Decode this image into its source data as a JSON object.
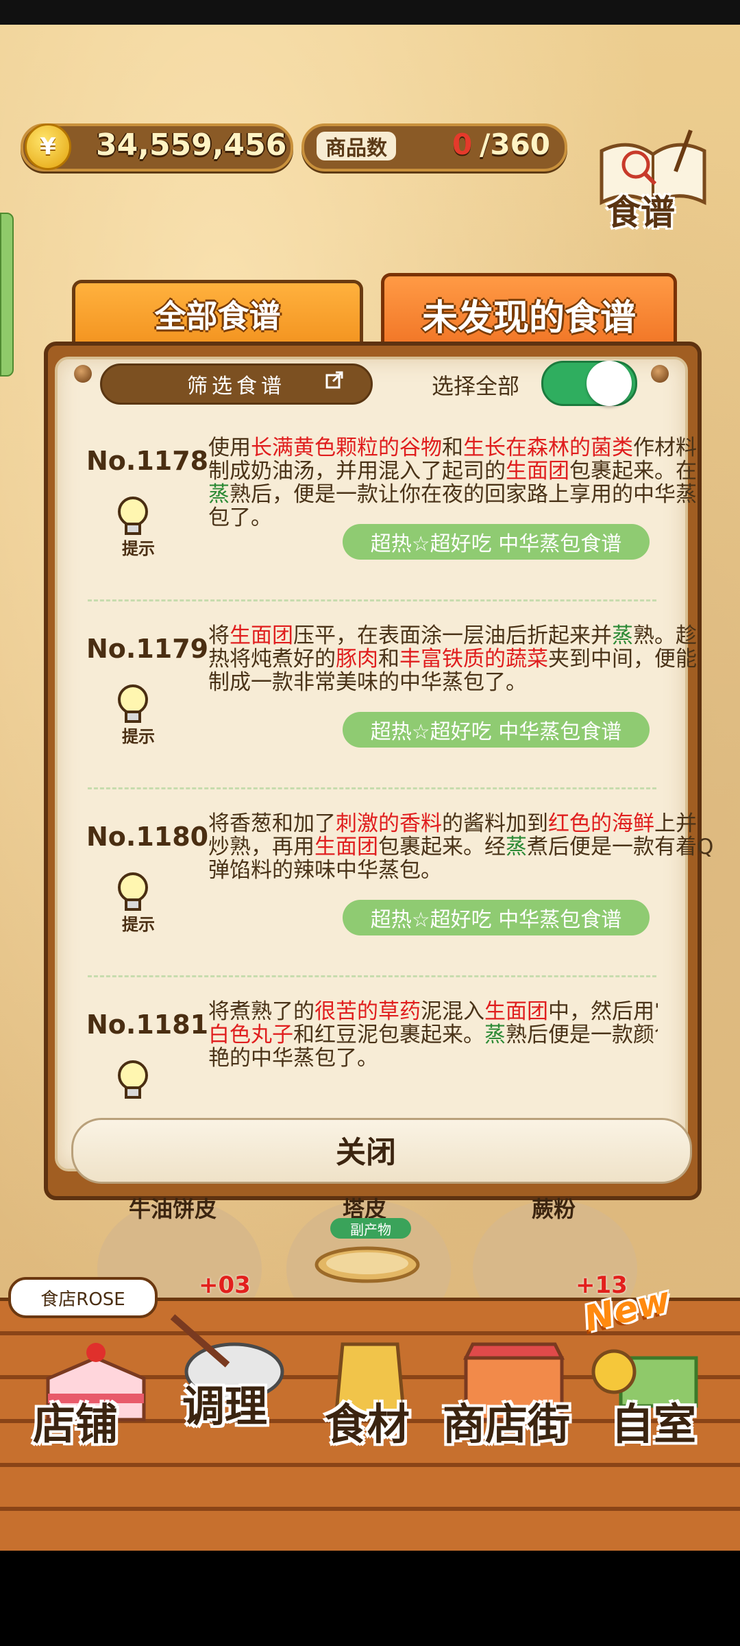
{
  "hud": {
    "money": "34,559,456",
    "money_icon": "¥",
    "goods_label": "商品数",
    "goods_count": "0",
    "goods_total": "/360",
    "recipe_book_label": "食谱"
  },
  "tabs": {
    "all": "全部食谱",
    "undiscovered": "未发现的食谱"
  },
  "toolbar": {
    "filter_label": "筛选食谱",
    "select_all_label": "选择全部",
    "select_all_on": true
  },
  "recipes": [
    {
      "number": "No.1178",
      "hint": "提示",
      "parts": [
        {
          "t": "使用",
          "c": ""
        },
        {
          "t": "长满黄色颗粒的谷物",
          "c": "r"
        },
        {
          "t": "和",
          "c": ""
        },
        {
          "t": "生长在森林的菌类",
          "c": "r"
        },
        {
          "t": "作材料制成奶油汤，并用混入了起司的",
          "c": ""
        },
        {
          "t": "生面团",
          "c": "r"
        },
        {
          "t": "包裹起来。在",
          "c": ""
        },
        {
          "t": "蒸",
          "c": "g"
        },
        {
          "t": "熟后，便是一款让你在夜的回家路上享用的中华蒸包了。",
          "c": ""
        }
      ],
      "tag": "超热☆超好吃 中华蒸包食谱"
    },
    {
      "number": "No.1179",
      "hint": "提示",
      "parts": [
        {
          "t": "将",
          "c": ""
        },
        {
          "t": "生面团",
          "c": "r"
        },
        {
          "t": "压平，在表面涂一层油后折起来并",
          "c": ""
        },
        {
          "t": "蒸",
          "c": "g"
        },
        {
          "t": "熟。趁热将炖煮好的",
          "c": ""
        },
        {
          "t": "豚肉",
          "c": "r"
        },
        {
          "t": "和",
          "c": ""
        },
        {
          "t": "丰富铁质的蔬菜",
          "c": "r"
        },
        {
          "t": "夹到中间，便能制成一款非常美味的中华蒸包了。",
          "c": ""
        }
      ],
      "tag": "超热☆超好吃 中华蒸包食谱"
    },
    {
      "number": "No.1180",
      "hint": "提示",
      "parts": [
        {
          "t": "将香葱和加了",
          "c": ""
        },
        {
          "t": "刺激的香料",
          "c": "r"
        },
        {
          "t": "的酱料加到",
          "c": ""
        },
        {
          "t": "红色的海鲜",
          "c": "r"
        },
        {
          "t": "上并炒熟，再用",
          "c": ""
        },
        {
          "t": "生面团",
          "c": "r"
        },
        {
          "t": "包裹起来。经",
          "c": ""
        },
        {
          "t": "蒸",
          "c": "g"
        },
        {
          "t": "煮后便是一款有着Q弹馅料的辣味中华蒸包。",
          "c": ""
        }
      ],
      "tag": "超热☆超好吃 中华蒸包食谱"
    },
    {
      "number": "No.1181",
      "hint": "提示",
      "parts": [
        {
          "t": "将煮熟了的",
          "c": ""
        },
        {
          "t": "很苦的草药",
          "c": "r"
        },
        {
          "t": "泥混入",
          "c": ""
        },
        {
          "t": "生面团",
          "c": "r"
        },
        {
          "t": "中，然后用它将",
          "c": ""
        },
        {
          "t": "白色丸子",
          "c": "r"
        },
        {
          "t": "和红豆泥包裹起来。",
          "c": ""
        },
        {
          "t": "蒸",
          "c": "g"
        },
        {
          "t": "熟后便是一款颜色鲜艳的中华蒸包了。",
          "c": ""
        }
      ],
      "tag": ""
    }
  ],
  "close_label": "关闭",
  "ingredients": [
    {
      "name": "牛油饼皮",
      "qty": "+03",
      "badge": ""
    },
    {
      "name": "塔皮",
      "qty": "",
      "badge": "副产物"
    },
    {
      "name": "蕨粉",
      "qty": "+13",
      "badge": ""
    }
  ],
  "shop_name": "食店ROSE",
  "nav": {
    "shop": "店铺",
    "cook": "调理",
    "ingredients": "食材",
    "street": "商店街",
    "home": "自室",
    "new_badge": "New"
  },
  "colors": {
    "highlight_red": "#e01e1e",
    "highlight_green": "#2c8a35",
    "tag_green": "#8fcb72",
    "toggle_on": "#2fae5f"
  }
}
